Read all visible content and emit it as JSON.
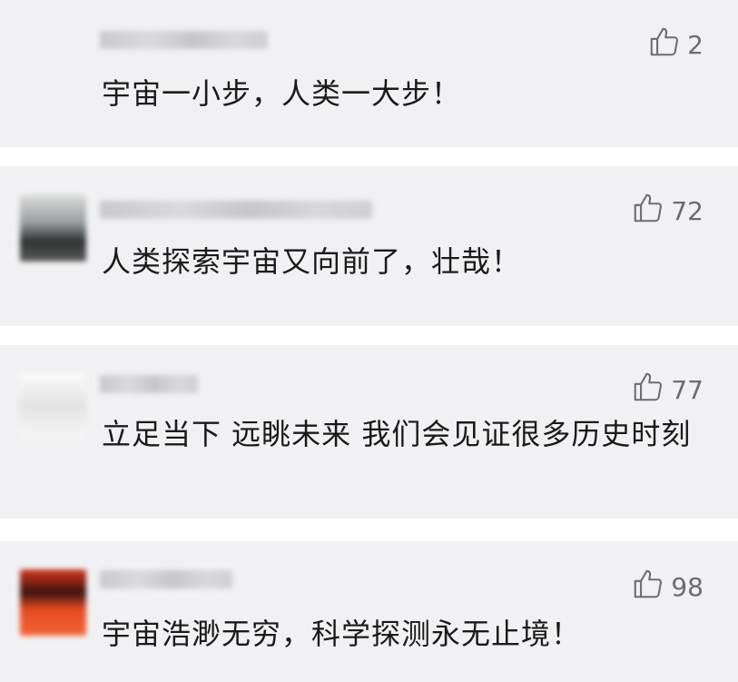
{
  "comments": [
    {
      "likes": "2",
      "text": "宇宙一小步，人类一大步！"
    },
    {
      "likes": "72",
      "text": "人类探索宇宙又向前了，壮哉！"
    },
    {
      "likes": "77",
      "text": "立足当下 远眺未来 我们会见证很多历史时刻"
    },
    {
      "likes": "98",
      "text": "宇宙浩渺无穷，科学探测永无止境！"
    }
  ],
  "icons": {
    "like": "thumbs-up-icon"
  },
  "colors": {
    "card_bg": "#f1f1f3",
    "text": "#1a1a1a",
    "like": "#6c6c70",
    "separator": "#ffffff"
  }
}
